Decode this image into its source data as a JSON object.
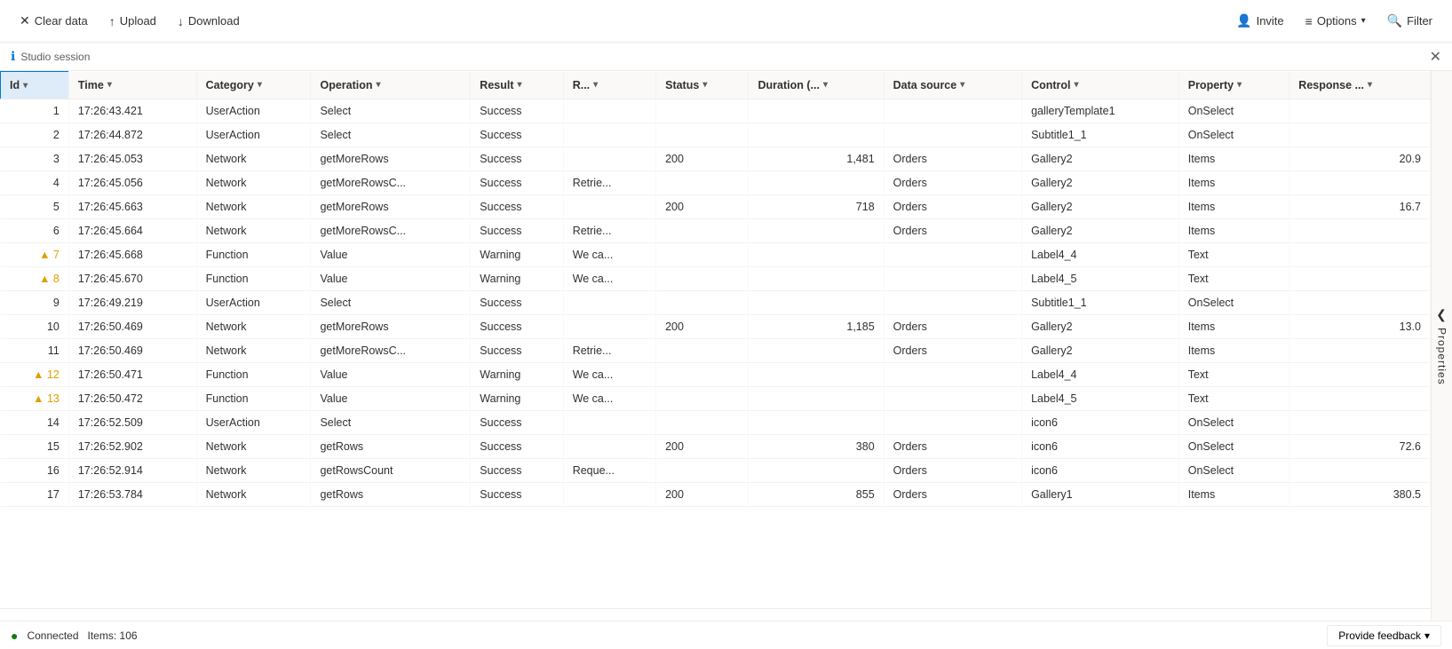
{
  "toolbar": {
    "clear_data_label": "Clear data",
    "upload_label": "Upload",
    "download_label": "Download",
    "invite_label": "Invite",
    "options_label": "Options",
    "filter_label": "Filter"
  },
  "session_bar": {
    "label": "Studio session"
  },
  "table": {
    "columns": [
      {
        "key": "id",
        "label": "Id",
        "sorted": true
      },
      {
        "key": "time",
        "label": "Time"
      },
      {
        "key": "category",
        "label": "Category"
      },
      {
        "key": "operation",
        "label": "Operation"
      },
      {
        "key": "result",
        "label": "Result"
      },
      {
        "key": "r",
        "label": "R..."
      },
      {
        "key": "status",
        "label": "Status"
      },
      {
        "key": "duration",
        "label": "Duration (..."
      },
      {
        "key": "datasource",
        "label": "Data source"
      },
      {
        "key": "control",
        "label": "Control"
      },
      {
        "key": "property",
        "label": "Property"
      },
      {
        "key": "response",
        "label": "Response ..."
      }
    ],
    "rows": [
      {
        "id": 1,
        "warn": false,
        "time": "17:26:43.421",
        "category": "UserAction",
        "operation": "Select",
        "result": "Success",
        "r": "",
        "status": "",
        "duration": "",
        "datasource": "",
        "control": "galleryTemplate1",
        "property": "OnSelect",
        "response": ""
      },
      {
        "id": 2,
        "warn": false,
        "time": "17:26:44.872",
        "category": "UserAction",
        "operation": "Select",
        "result": "Success",
        "r": "",
        "status": "",
        "duration": "",
        "datasource": "",
        "control": "Subtitle1_1",
        "property": "OnSelect",
        "response": ""
      },
      {
        "id": 3,
        "warn": false,
        "time": "17:26:45.053",
        "category": "Network",
        "operation": "getMoreRows",
        "result": "Success",
        "r": "",
        "status": "200",
        "duration": "1,481",
        "datasource": "Orders",
        "control": "Gallery2",
        "property": "Items",
        "response": "20.9"
      },
      {
        "id": 4,
        "warn": false,
        "time": "17:26:45.056",
        "category": "Network",
        "operation": "getMoreRowsC...",
        "result": "Success",
        "r": "Retrie...",
        "status": "",
        "duration": "",
        "datasource": "Orders",
        "control": "Gallery2",
        "property": "Items",
        "response": ""
      },
      {
        "id": 5,
        "warn": false,
        "time": "17:26:45.663",
        "category": "Network",
        "operation": "getMoreRows",
        "result": "Success",
        "r": "",
        "status": "200",
        "duration": "718",
        "datasource": "Orders",
        "control": "Gallery2",
        "property": "Items",
        "response": "16.7"
      },
      {
        "id": 6,
        "warn": false,
        "time": "17:26:45.664",
        "category": "Network",
        "operation": "getMoreRowsC...",
        "result": "Success",
        "r": "Retrie...",
        "status": "",
        "duration": "",
        "datasource": "Orders",
        "control": "Gallery2",
        "property": "Items",
        "response": ""
      },
      {
        "id": 7,
        "warn": true,
        "time": "17:26:45.668",
        "category": "Function",
        "operation": "Value",
        "result": "Warning",
        "r": "We ca...",
        "status": "",
        "duration": "",
        "datasource": "",
        "control": "Label4_4",
        "property": "Text",
        "response": ""
      },
      {
        "id": 8,
        "warn": true,
        "time": "17:26:45.670",
        "category": "Function",
        "operation": "Value",
        "result": "Warning",
        "r": "We ca...",
        "status": "",
        "duration": "",
        "datasource": "",
        "control": "Label4_5",
        "property": "Text",
        "response": ""
      },
      {
        "id": 9,
        "warn": false,
        "time": "17:26:49.219",
        "category": "UserAction",
        "operation": "Select",
        "result": "Success",
        "r": "",
        "status": "",
        "duration": "",
        "datasource": "",
        "control": "Subtitle1_1",
        "property": "OnSelect",
        "response": ""
      },
      {
        "id": 10,
        "warn": false,
        "time": "17:26:50.469",
        "category": "Network",
        "operation": "getMoreRows",
        "result": "Success",
        "r": "",
        "status": "200",
        "duration": "1,185",
        "datasource": "Orders",
        "control": "Gallery2",
        "property": "Items",
        "response": "13.0"
      },
      {
        "id": 11,
        "warn": false,
        "time": "17:26:50.469",
        "category": "Network",
        "operation": "getMoreRowsC...",
        "result": "Success",
        "r": "Retrie...",
        "status": "",
        "duration": "",
        "datasource": "Orders",
        "control": "Gallery2",
        "property": "Items",
        "response": ""
      },
      {
        "id": 12,
        "warn": true,
        "time": "17:26:50.471",
        "category": "Function",
        "operation": "Value",
        "result": "Warning",
        "r": "We ca...",
        "status": "",
        "duration": "",
        "datasource": "",
        "control": "Label4_4",
        "property": "Text",
        "response": ""
      },
      {
        "id": 13,
        "warn": true,
        "time": "17:26:50.472",
        "category": "Function",
        "operation": "Value",
        "result": "Warning",
        "r": "We ca...",
        "status": "",
        "duration": "",
        "datasource": "",
        "control": "Label4_5",
        "property": "Text",
        "response": ""
      },
      {
        "id": 14,
        "warn": false,
        "time": "17:26:52.509",
        "category": "UserAction",
        "operation": "Select",
        "result": "Success",
        "r": "",
        "status": "",
        "duration": "",
        "datasource": "",
        "control": "icon6",
        "property": "OnSelect",
        "response": ""
      },
      {
        "id": 15,
        "warn": false,
        "time": "17:26:52.902",
        "category": "Network",
        "operation": "getRows",
        "result": "Success",
        "r": "",
        "status": "200",
        "duration": "380",
        "datasource": "Orders",
        "control": "icon6",
        "property": "OnSelect",
        "response": "72.6"
      },
      {
        "id": 16,
        "warn": false,
        "time": "17:26:52.914",
        "category": "Network",
        "operation": "getRowsCount",
        "result": "Success",
        "r": "Reque...",
        "status": "",
        "duration": "",
        "datasource": "Orders",
        "control": "icon6",
        "property": "OnSelect",
        "response": ""
      },
      {
        "id": 17,
        "warn": false,
        "time": "17:26:53.784",
        "category": "Network",
        "operation": "getRows",
        "result": "Success",
        "r": "",
        "status": "200",
        "duration": "855",
        "datasource": "Orders",
        "control": "Gallery1",
        "property": "Items",
        "response": "380.5"
      }
    ]
  },
  "right_panel": {
    "label": "Properties",
    "arrow": "❯"
  },
  "status_bar": {
    "connected_label": "Connected",
    "items_label": "Items: 106",
    "feedback_label": "Provide feedback"
  }
}
